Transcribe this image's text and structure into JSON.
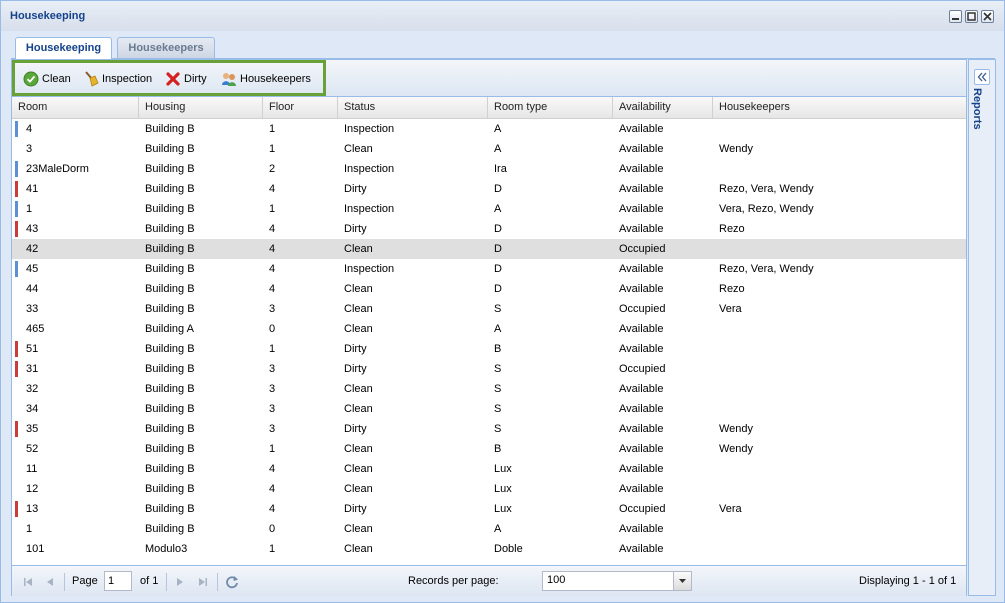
{
  "window": {
    "title": "Housekeeping"
  },
  "tabs": [
    {
      "label": "Housekeeping",
      "active": true
    },
    {
      "label": "Housekeepers",
      "active": false
    }
  ],
  "toolbar": {
    "clean_label": "Clean",
    "inspection_label": "Inspection",
    "dirty_label": "Dirty",
    "housekeepers_label": "Housekeepers"
  },
  "columns": [
    "Room",
    "Housing",
    "Floor",
    "Status",
    "Room type",
    "Availability",
    "Housekeepers"
  ],
  "status_colors": {
    "Inspection": "#5b8fd6",
    "Dirty": "#c83c3c",
    "Clean": ""
  },
  "rows": [
    {
      "room": "4",
      "housing": "Building B",
      "floor": "1",
      "status": "Inspection",
      "room_type": "A",
      "availability": "Available",
      "housekeepers": ""
    },
    {
      "room": "3",
      "housing": "Building B",
      "floor": "1",
      "status": "Clean",
      "room_type": "A",
      "availability": "Available",
      "housekeepers": "Wendy"
    },
    {
      "room": "23MaleDorm",
      "housing": "Building B",
      "floor": "2",
      "status": "Inspection",
      "room_type": "Ira",
      "availability": "Available",
      "housekeepers": ""
    },
    {
      "room": "41",
      "housing": "Building B",
      "floor": "4",
      "status": "Dirty",
      "room_type": "D",
      "availability": "Available",
      "housekeepers": "Rezo, Vera, Wendy"
    },
    {
      "room": "1",
      "housing": "Building B",
      "floor": "1",
      "status": "Inspection",
      "room_type": "A",
      "availability": "Available",
      "housekeepers": "Vera, Rezo, Wendy"
    },
    {
      "room": "43",
      "housing": "Building B",
      "floor": "4",
      "status": "Dirty",
      "room_type": "D",
      "availability": "Available",
      "housekeepers": "Rezo"
    },
    {
      "room": "42",
      "housing": "Building B",
      "floor": "4",
      "status": "Clean",
      "room_type": "D",
      "availability": "Occupied",
      "housekeepers": "",
      "selected": true
    },
    {
      "room": "45",
      "housing": "Building B",
      "floor": "4",
      "status": "Inspection",
      "room_type": "D",
      "availability": "Available",
      "housekeepers": "Rezo, Vera, Wendy"
    },
    {
      "room": "44",
      "housing": "Building B",
      "floor": "4",
      "status": "Clean",
      "room_type": "D",
      "availability": "Available",
      "housekeepers": "Rezo"
    },
    {
      "room": "33",
      "housing": "Building B",
      "floor": "3",
      "status": "Clean",
      "room_type": "S",
      "availability": "Occupied",
      "housekeepers": "Vera"
    },
    {
      "room": "465",
      "housing": "Building A",
      "floor": "0",
      "status": "Clean",
      "room_type": "A",
      "availability": "Available",
      "housekeepers": ""
    },
    {
      "room": "51",
      "housing": "Building B",
      "floor": "1",
      "status": "Dirty",
      "room_type": "B",
      "availability": "Available",
      "housekeepers": ""
    },
    {
      "room": "31",
      "housing": "Building B",
      "floor": "3",
      "status": "Dirty",
      "room_type": "S",
      "availability": "Occupied",
      "housekeepers": ""
    },
    {
      "room": "32",
      "housing": "Building B",
      "floor": "3",
      "status": "Clean",
      "room_type": "S",
      "availability": "Available",
      "housekeepers": ""
    },
    {
      "room": "34",
      "housing": "Building B",
      "floor": "3",
      "status": "Clean",
      "room_type": "S",
      "availability": "Available",
      "housekeepers": ""
    },
    {
      "room": "35",
      "housing": "Building B",
      "floor": "3",
      "status": "Dirty",
      "room_type": "S",
      "availability": "Available",
      "housekeepers": "Wendy"
    },
    {
      "room": "52",
      "housing": "Building B",
      "floor": "1",
      "status": "Clean",
      "room_type": "B",
      "availability": "Available",
      "housekeepers": "Wendy"
    },
    {
      "room": "11",
      "housing": "Building B",
      "floor": "4",
      "status": "Clean",
      "room_type": "Lux",
      "availability": "Available",
      "housekeepers": ""
    },
    {
      "room": "12",
      "housing": "Building B",
      "floor": "4",
      "status": "Clean",
      "room_type": "Lux",
      "availability": "Available",
      "housekeepers": ""
    },
    {
      "room": "13",
      "housing": "Building B",
      "floor": "4",
      "status": "Dirty",
      "room_type": "Lux",
      "availability": "Occupied",
      "housekeepers": "Vera"
    },
    {
      "room": "1",
      "housing": "Building B",
      "floor": "0",
      "status": "Clean",
      "room_type": "A",
      "availability": "Available",
      "housekeepers": ""
    },
    {
      "room": "101",
      "housing": "Modulo3",
      "floor": "1",
      "status": "Clean",
      "room_type": "Doble",
      "availability": "Available",
      "housekeepers": ""
    }
  ],
  "pager": {
    "page_label": "Page",
    "page_value": "1",
    "of_label": "of 1",
    "records_per_page_label": "Records per page:",
    "records_per_page_value": "100",
    "display_text": "Displaying 1 - 1 of 1"
  },
  "side_panel": {
    "label": "Reports"
  },
  "icons": {
    "clean": "check-circle-icon",
    "inspection": "broom-icon",
    "dirty": "red-x-icon",
    "housekeepers": "people-icon"
  }
}
